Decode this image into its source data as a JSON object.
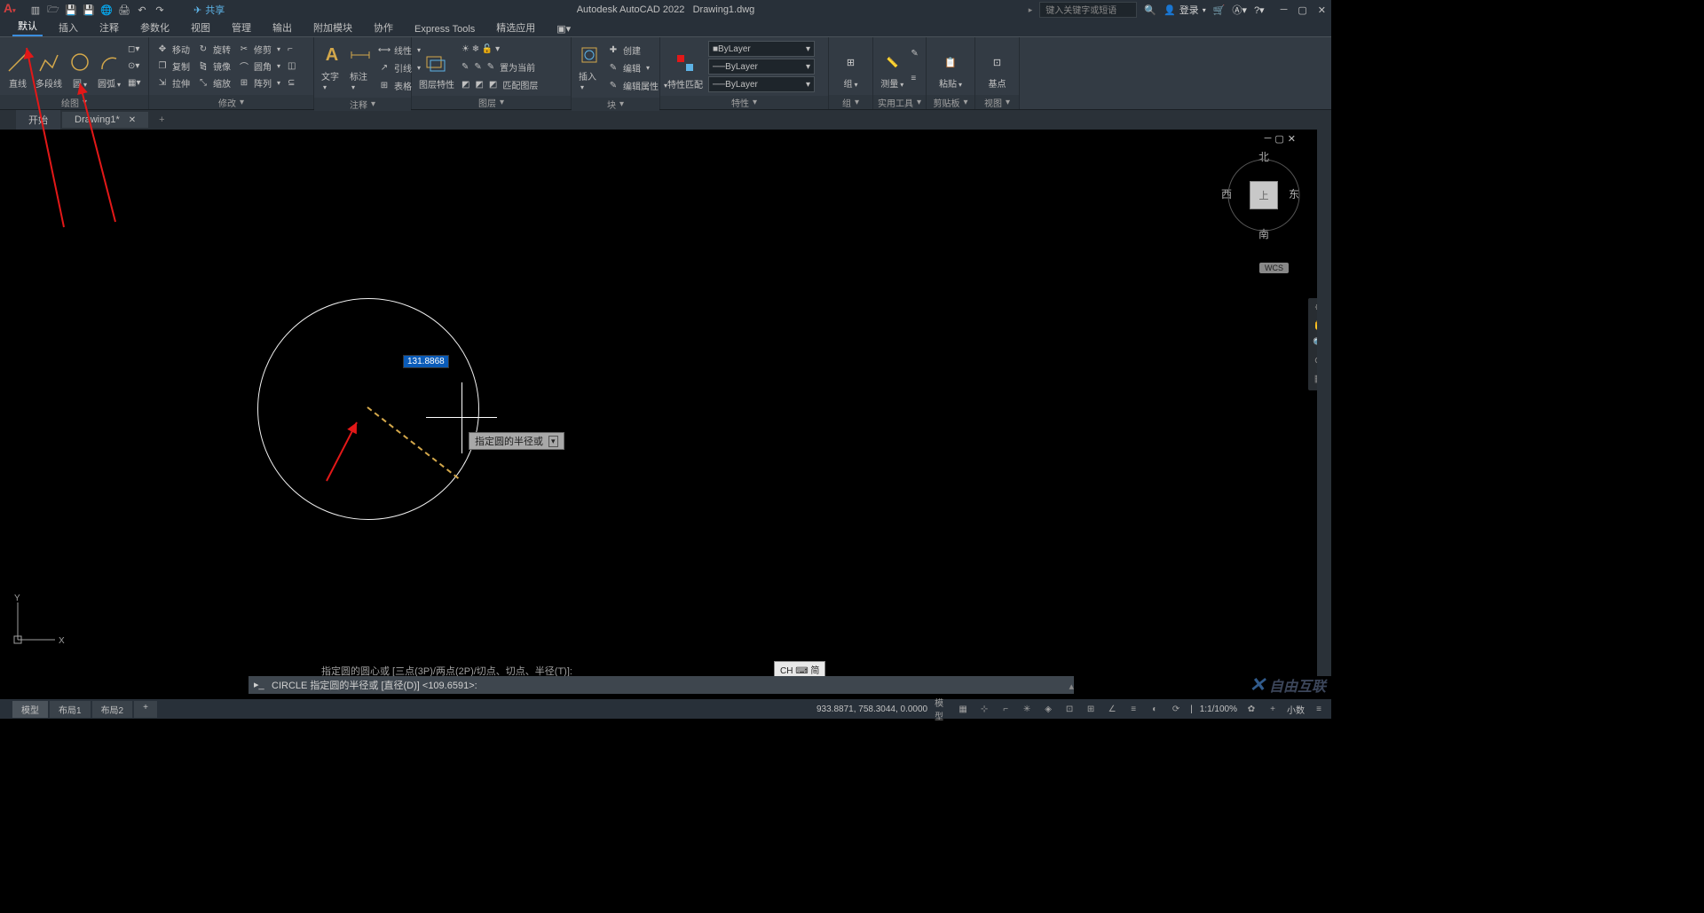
{
  "title": {
    "app": "Autodesk AutoCAD 2022",
    "file": "Drawing1.dwg",
    "share": "共享",
    "search_placeholder": "键入关键字或短语",
    "login": "登录"
  },
  "ribbon_tabs": [
    "默认",
    "插入",
    "注释",
    "参数化",
    "视图",
    "管理",
    "输出",
    "附加模块",
    "协作",
    "Express Tools",
    "精选应用"
  ],
  "panels": {
    "draw": {
      "title": "绘图",
      "line": "直线",
      "polyline": "多段线",
      "circle": "圆",
      "arc": "圆弧"
    },
    "modify": {
      "title": "修改",
      "move": "移动",
      "rotate": "旋转",
      "trim": "修剪",
      "copy": "复制",
      "mirror": "镜像",
      "fillet": "圆角",
      "stretch": "拉伸",
      "scale": "缩放",
      "array": "阵列"
    },
    "annot": {
      "title": "注释",
      "text": "文字",
      "dim": "标注",
      "leader": "引线",
      "table": "表格",
      "linear": "线性"
    },
    "layer": {
      "title": "图层",
      "props": "图层特性",
      "make_current": "置为当前",
      "match": "匹配图层"
    },
    "block": {
      "title": "块",
      "insert": "插入",
      "create": "创建",
      "edit": "编辑",
      "edit_attr": "编辑属性"
    },
    "props": {
      "title": "特性",
      "match": "特性匹配",
      "bylayer1": "ByLayer",
      "bylayer2": "ByLayer",
      "bylayer3": "ByLayer"
    },
    "group": {
      "title": "组",
      "label": "组"
    },
    "util": {
      "title": "实用工具",
      "measure": "测量"
    },
    "clip": {
      "title": "剪贴板",
      "paste": "粘贴"
    },
    "view": {
      "title": "视图",
      "base": "基点"
    }
  },
  "doc_tabs": {
    "start": "开始",
    "drawing": "Drawing1*"
  },
  "viewcube": {
    "north": "北",
    "south": "南",
    "east": "东",
    "west": "西",
    "top": "上",
    "wcs": "WCS"
  },
  "canvas": {
    "dyn_value": "131.8868",
    "tooltip": "指定圆的半径或",
    "cmd_hint": "指定圆的圆心或 [三点(3P)/两点(2P)/切点、切点、半径(T)]:",
    "cmd_current": "CIRCLE 指定圆的半径或 [直径(D)] <109.6591>:",
    "ime_badge": "CH ⌨ 简"
  },
  "status": {
    "model": "模型",
    "layout1": "布局1",
    "layout2": "布局2",
    "coords": "933.8871, 758.3044, 0.0000",
    "mode": "模型",
    "scale": "1:1/100%",
    "decimal": "小数"
  },
  "watermark": "自由互联"
}
